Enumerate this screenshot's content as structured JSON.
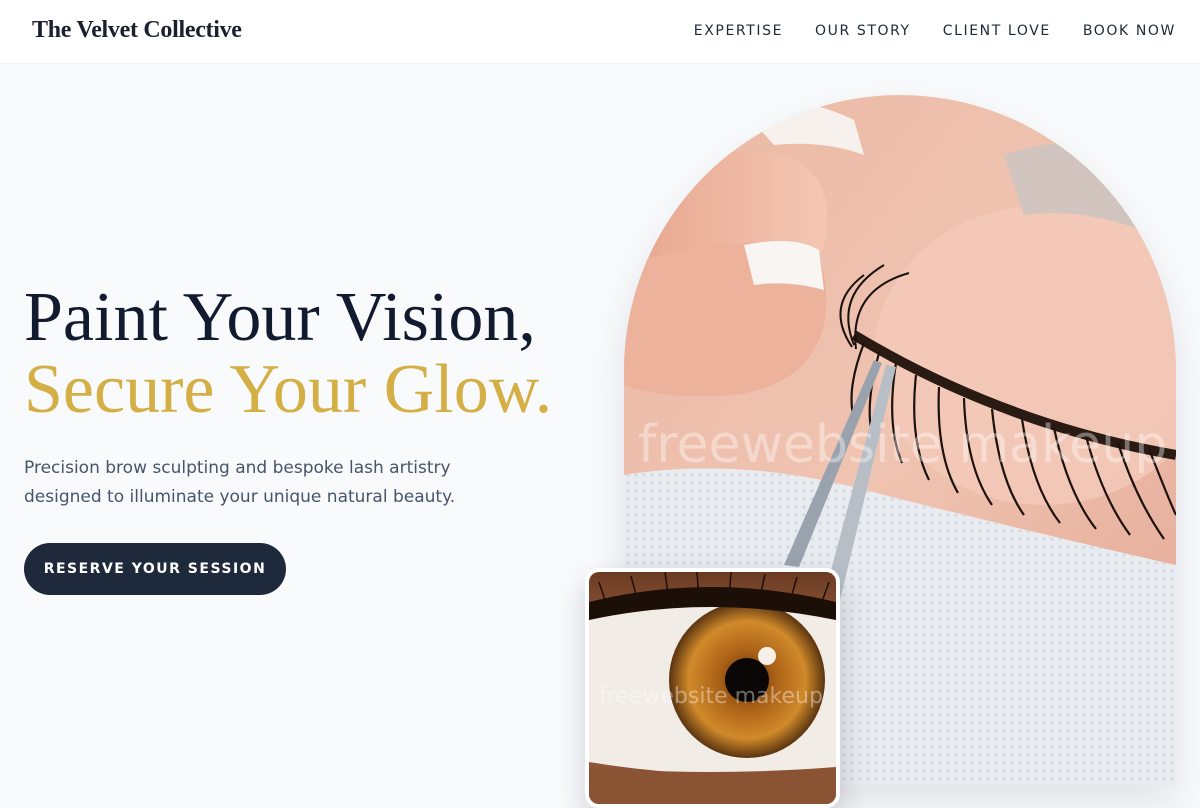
{
  "brand": {
    "name": "The Velvet Collective"
  },
  "nav": {
    "items": [
      {
        "label": "EXPERTISE"
      },
      {
        "label": "OUR STORY"
      },
      {
        "label": "CLIENT LOVE"
      },
      {
        "label": "BOOK NOW"
      }
    ]
  },
  "hero": {
    "title_line1": "Paint Your Vision,",
    "title_line2": "Secure Your Glow.",
    "subtitle": "Precision brow sculpting and bespoke lash artistry designed to illuminate your unique natural beauty.",
    "cta_label": "RESERVE YOUR SESSION"
  },
  "images": {
    "main_watermark": "freewebsite makeup",
    "inset_watermark": "freewebsite makeup"
  },
  "colors": {
    "heading": "#111a2e",
    "accent_gold": "#d4af45",
    "button_bg": "#1e293b",
    "body_text": "#475569",
    "page_bg": "#f8fafc"
  }
}
